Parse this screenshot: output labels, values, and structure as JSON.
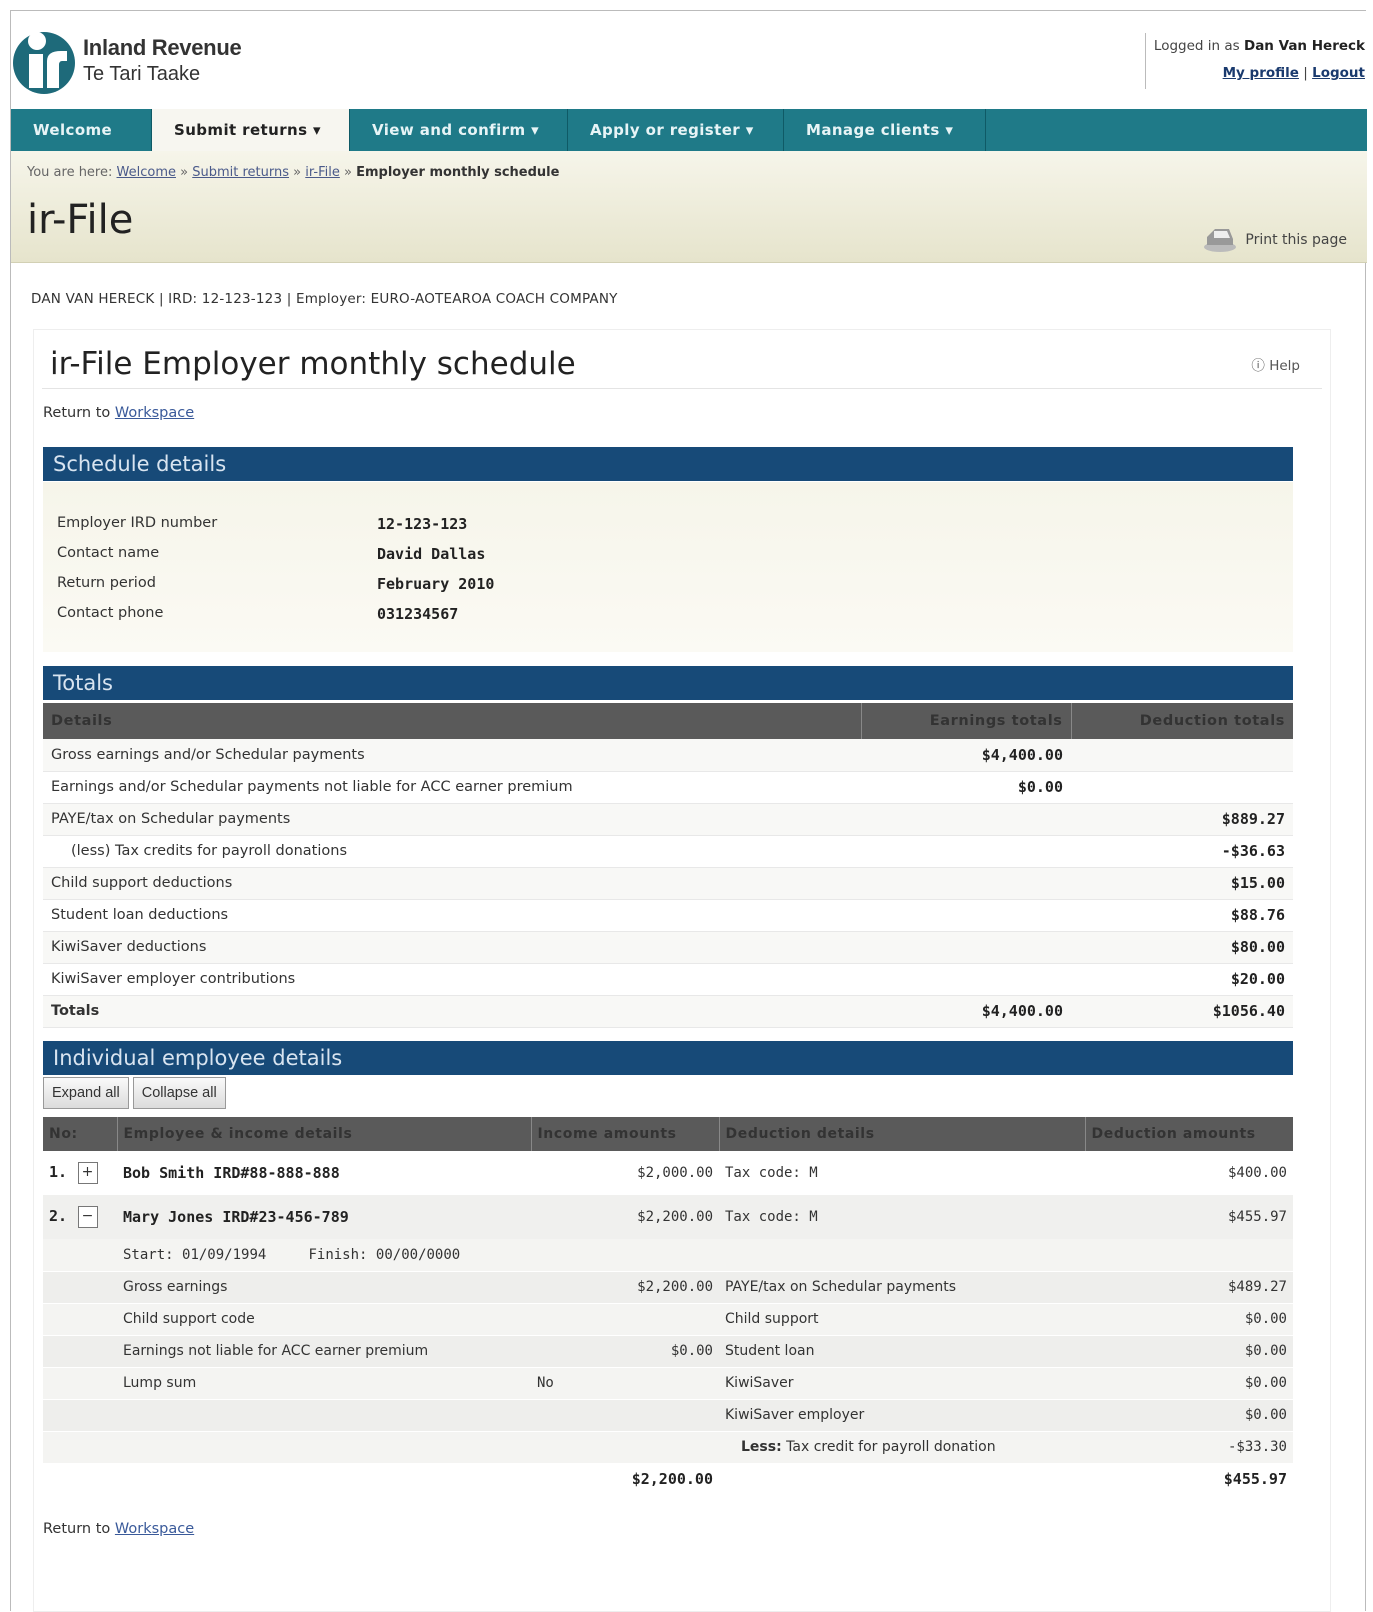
{
  "brand": {
    "line1": "Inland Revenue",
    "line2": "Te Tari Taake"
  },
  "login": {
    "prefix": "Logged in as",
    "user": "Dan Van Hereck",
    "profile": "My profile",
    "divider": "|",
    "logout": "Logout"
  },
  "nav": [
    "Welcome",
    "Submit returns ▾",
    "View and confirm ▾",
    "Apply or register ▾",
    "Manage clients ▾"
  ],
  "breadcrumb": {
    "prefix": "You are here:",
    "items": [
      "Welcome",
      "Submit returns",
      "ir-File"
    ],
    "sep": "»",
    "current": "Employer monthly schedule"
  },
  "page_title": "ir-File",
  "print_label": "Print this page",
  "user_line": "DAN VAN HERECK | IRD: 12-123-123 | Employer: EURO-AOTEAROA COACH COMPANY",
  "heading": "ir-File Employer monthly schedule",
  "help_label": "Help",
  "return": {
    "prefix": "Return to",
    "link": "Workspace"
  },
  "schedule": {
    "title": "Schedule details",
    "rows": [
      {
        "label": "Employer IRD number",
        "value": "12-123-123"
      },
      {
        "label": "Contact name",
        "value": "David Dallas"
      },
      {
        "label": "Return period",
        "value": "February 2010"
      },
      {
        "label": "Contact phone",
        "value": "031234567"
      }
    ]
  },
  "totals": {
    "title": "Totals",
    "headers": [
      "Details",
      "Earnings totals",
      "Deduction totals"
    ],
    "rows": [
      {
        "label": "Gross earnings and/or Schedular payments",
        "earn": "$4,400.00",
        "ded": ""
      },
      {
        "label": "Earnings and/or Schedular payments not liable for ACC earner premium",
        "earn": "$0.00",
        "ded": ""
      },
      {
        "label": "PAYE/tax on Schedular payments",
        "earn": "",
        "ded": "$889.27"
      },
      {
        "label": "(less) Tax credits for payroll donations",
        "earn": "",
        "ded": "-$36.63"
      },
      {
        "label": "Child support deductions",
        "earn": "",
        "ded": "$15.00"
      },
      {
        "label": "Student loan deductions",
        "earn": "",
        "ded": "$88.76"
      },
      {
        "label": "KiwiSaver deductions",
        "earn": "",
        "ded": "$80.00"
      },
      {
        "label": "KiwiSaver employer contributions",
        "earn": "",
        "ded": "$20.00"
      },
      {
        "label": "Totals",
        "earn": "$4,400.00",
        "ded": "$1056.40"
      }
    ]
  },
  "employees": {
    "title": "Individual employee details",
    "expand_all": "Expand all",
    "collapse_all": "Collapse all",
    "headers": [
      "No:",
      "Employee & income details",
      "Income amounts",
      "Deduction details",
      "Deduction amounts"
    ],
    "rows": [
      {
        "no": "1.",
        "toggle": "+",
        "name": "Bob Smith IRD#88-888-888",
        "income": "$2,000.00",
        "ded_detail": "Tax code: M",
        "ded_amount": "$400.00"
      },
      {
        "no": "2.",
        "toggle": "−",
        "name": "Mary Jones IRD#23-456-789",
        "income": "$2,200.00",
        "ded_detail": "Tax code: M",
        "ded_amount": "$455.97"
      }
    ],
    "dates": {
      "start_label": "Start:",
      "start": "01/09/1994",
      "finish_label": "Finish:",
      "finish": "00/00/0000"
    },
    "details": [
      {
        "label": "Gross earnings",
        "income": "$2,200.00",
        "ded_label": "PAYE/tax on Schedular payments",
        "ded": "$489.27"
      },
      {
        "label": "Child support code",
        "income": "",
        "ded_label": "Child support",
        "ded": "$0.00"
      },
      {
        "label": "Earnings not liable for ACC earner premium",
        "income": "$0.00",
        "ded_label": "Student loan",
        "ded": "$0.00"
      },
      {
        "label": "Lump sum",
        "income_text": "No",
        "ded_label": "KiwiSaver",
        "ded": "$0.00"
      },
      {
        "label": "",
        "income": "",
        "ded_label": "KiwiSaver employer",
        "ded": "$0.00"
      }
    ],
    "less": {
      "label": "Less:",
      "text": "Tax credit for payroll donation",
      "amount": "-$33.30"
    },
    "total": {
      "income": "$2,200.00",
      "ded": "$455.97"
    }
  }
}
